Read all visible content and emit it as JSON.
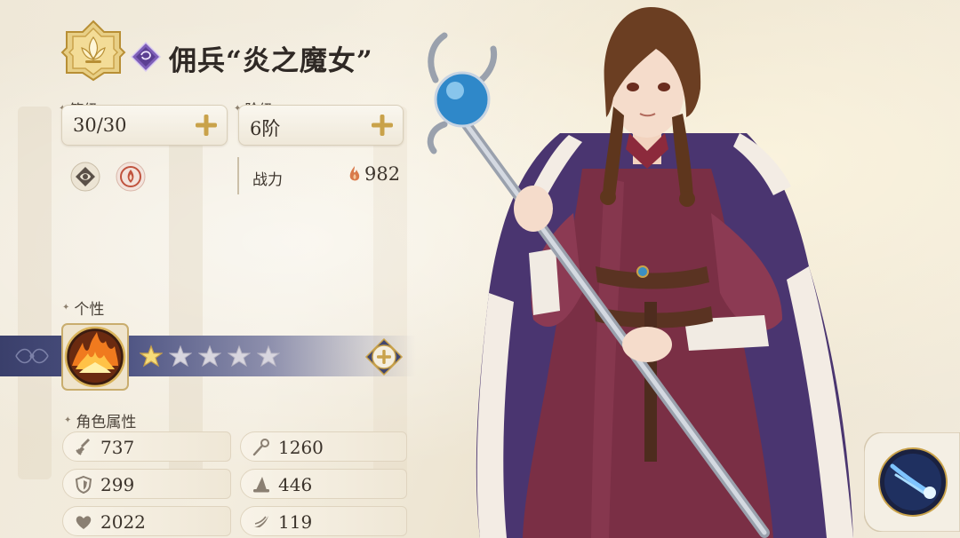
{
  "header": {
    "title": "佣兵“炎之魔女”",
    "emblem_icon": "golden-lotus-emblem-icon",
    "class_icon": "purple-rune-class-icon"
  },
  "level": {
    "label": "等级",
    "value": "30/30"
  },
  "rank": {
    "label": "阶级",
    "value": "6阶"
  },
  "traits": [
    "earth-element-icon",
    "fire-element-icon"
  ],
  "power": {
    "label": "战力",
    "value": "982",
    "icon": "flame-icon"
  },
  "personality": {
    "label": "个性",
    "skill_icon": "fire-burst-icon",
    "stars_filled": 1,
    "stars_total": 5
  },
  "attributes": {
    "label": "角色属性",
    "items": [
      {
        "icon": "sword-icon",
        "value": "737"
      },
      {
        "icon": "staff-icon",
        "value": "1260"
      },
      {
        "icon": "shield-icon",
        "value": "299"
      },
      {
        "icon": "wizard-hat-icon",
        "value": "446"
      },
      {
        "icon": "heart-icon",
        "value": "2022"
      },
      {
        "icon": "wing-icon",
        "value": "119"
      }
    ]
  },
  "skill_button": {
    "icon": "comet-skill-icon"
  },
  "colors": {
    "accent_gold": "#c9a24a",
    "band_navy": "#3a3f6b",
    "robe_crimson": "#7a2f45",
    "cloak_purple": "#4a3570"
  }
}
